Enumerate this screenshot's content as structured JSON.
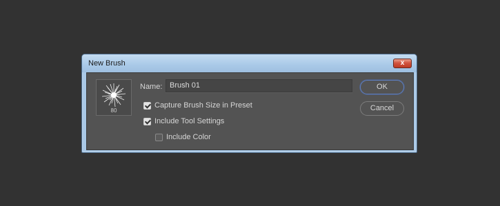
{
  "dialog": {
    "title": "New Brush",
    "close_symbol": "x"
  },
  "brush": {
    "size": "80",
    "icon": "brush-tip-splatter"
  },
  "name_field": {
    "label": "Name:",
    "value": "Brush 01"
  },
  "options": [
    {
      "label": "Capture Brush Size in Preset",
      "checked": true
    },
    {
      "label": "Include Tool Settings",
      "checked": true
    },
    {
      "label": "Include Color",
      "checked": false
    }
  ],
  "buttons": {
    "ok": "OK",
    "cancel": "Cancel"
  },
  "colors": {
    "background": "#323232",
    "dialog_body": "#535353",
    "titlebar": "#a9c9e8",
    "close": "#c9452f"
  }
}
